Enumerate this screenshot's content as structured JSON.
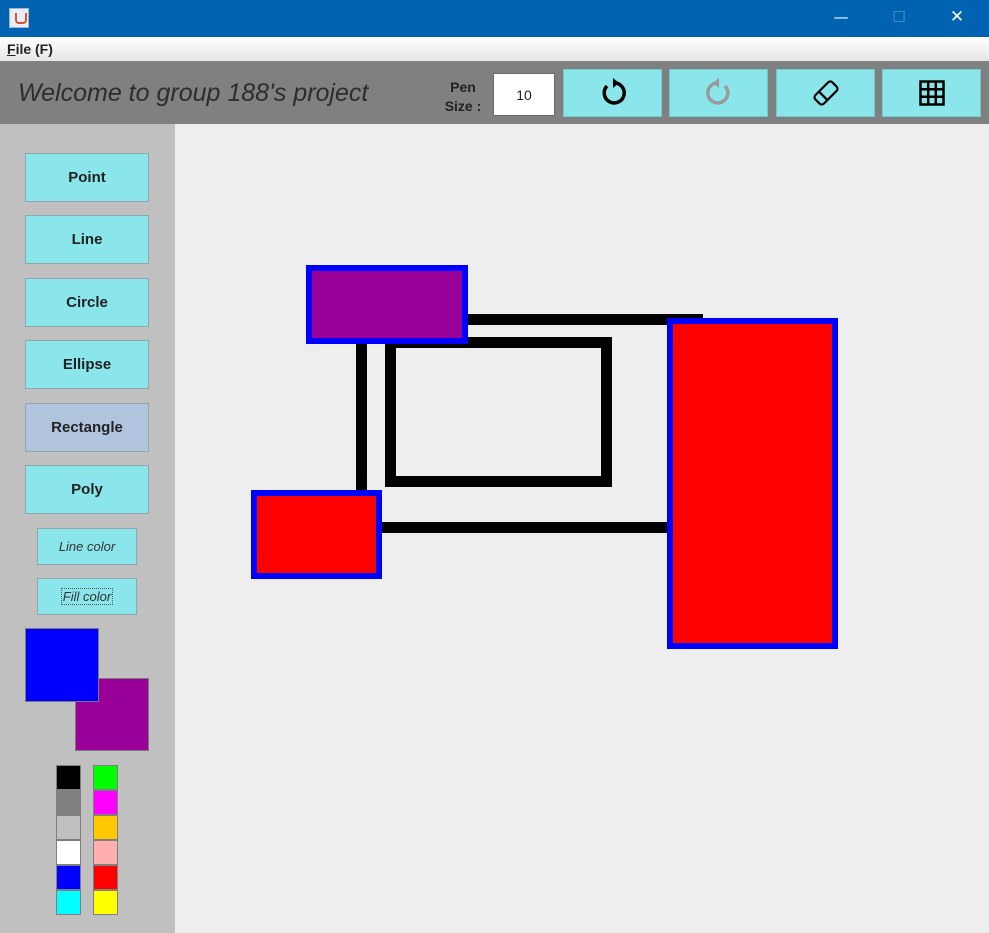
{
  "window": {
    "minimize_glyph": "—",
    "maximize_glyph": "☐",
    "close_glyph": "✕"
  },
  "menu": {
    "file_mnemonic": "F",
    "file_rest": "ile (F)"
  },
  "toolbar": {
    "welcome": "Welcome to group 188's project",
    "pen_label_line1": "Pen",
    "pen_label_line2": "Size :",
    "pen_size": "10",
    "icons": [
      "undo-icon",
      "redo-icon",
      "eraser-icon",
      "grid-icon"
    ]
  },
  "tools": {
    "point": "Point",
    "line": "Line",
    "circle": "Circle",
    "ellipse": "Ellipse",
    "rectangle": "Rectangle",
    "poly": "Poly",
    "selected": "Rectangle"
  },
  "colors": {
    "line_color_label": "Line color",
    "fill_color_label": "Fill color",
    "current_line": "#0000ff",
    "current_fill": "#990099",
    "palette_left": [
      "#000000",
      "#808080",
      "#c0c0c0",
      "#ffffff",
      "#0000ff",
      "#00ffff"
    ],
    "palette_right": [
      "#00ff00",
      "#ff00ff",
      "#ffc800",
      "#ffafaf",
      "#ff0000",
      "#ffff00"
    ]
  },
  "canvas_shapes": [
    {
      "kind": "rectangle",
      "stroke": "#000000",
      "fill": "none"
    },
    {
      "kind": "rectangle",
      "stroke": "#000000",
      "fill": "none"
    },
    {
      "kind": "rectangle",
      "stroke": "#0000ff",
      "fill": "#990099"
    },
    {
      "kind": "rectangle",
      "stroke": "#0000ff",
      "fill": "#ff0000"
    },
    {
      "kind": "rectangle",
      "stroke": "#0000ff",
      "fill": "#ff0000"
    }
  ]
}
